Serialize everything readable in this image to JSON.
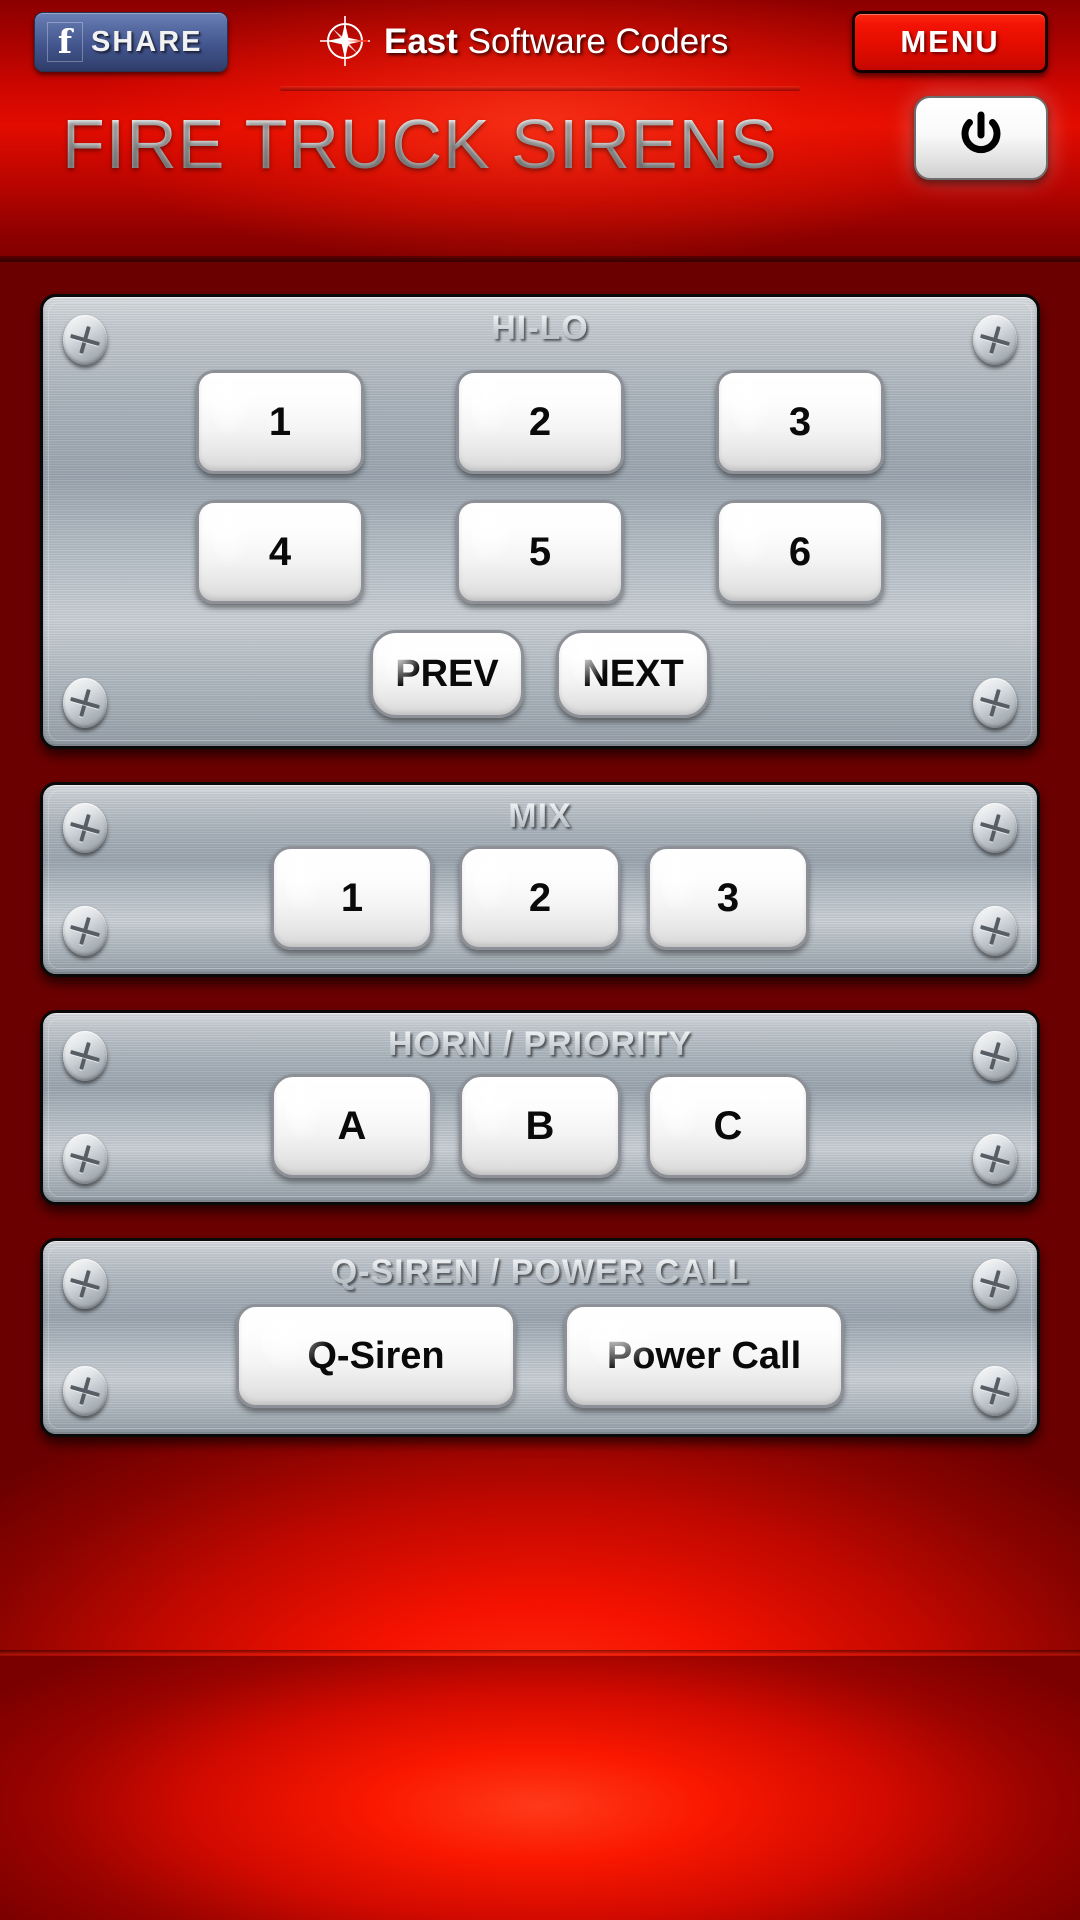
{
  "header": {
    "share_button": {
      "label": "SHARE",
      "icon": "facebook-f-icon"
    },
    "brand": {
      "bold": "East",
      "light": " Software Coders",
      "icon": "compass-rose-icon"
    },
    "menu_button": {
      "label": "MENU"
    },
    "app_title": "FIRE TRUCK SIRENS",
    "power_button": {
      "icon": "power-icon"
    }
  },
  "panels": [
    {
      "id": "hilo",
      "title": "HI-LO",
      "rows": [
        {
          "buttons": [
            {
              "label": "1"
            },
            {
              "label": "2"
            },
            {
              "label": "3"
            }
          ]
        },
        {
          "buttons": [
            {
              "label": "4"
            },
            {
              "label": "5"
            },
            {
              "label": "6"
            }
          ]
        }
      ],
      "nav": [
        {
          "label": "PREV"
        },
        {
          "label": "NEXT"
        }
      ]
    },
    {
      "id": "mix",
      "title": "MIX",
      "buttons": [
        {
          "label": "1"
        },
        {
          "label": "2"
        },
        {
          "label": "3"
        }
      ]
    },
    {
      "id": "horn",
      "title": "HORN / PRIORITY",
      "buttons": [
        {
          "label": "A"
        },
        {
          "label": "B"
        },
        {
          "label": "C"
        }
      ]
    },
    {
      "id": "qsiren",
      "title": "Q-SIREN / POWER CALL",
      "buttons": [
        {
          "label": "Q-Siren"
        },
        {
          "label": "Power Call"
        }
      ]
    }
  ],
  "colors": {
    "background_red": "#c00800",
    "accent_red": "#f01100",
    "menu_red": "#e60d00",
    "facebook_blue": "#41548c",
    "metal_light": "#d6dade",
    "metal_dark": "#949da6",
    "button_white": "#ffffff"
  }
}
